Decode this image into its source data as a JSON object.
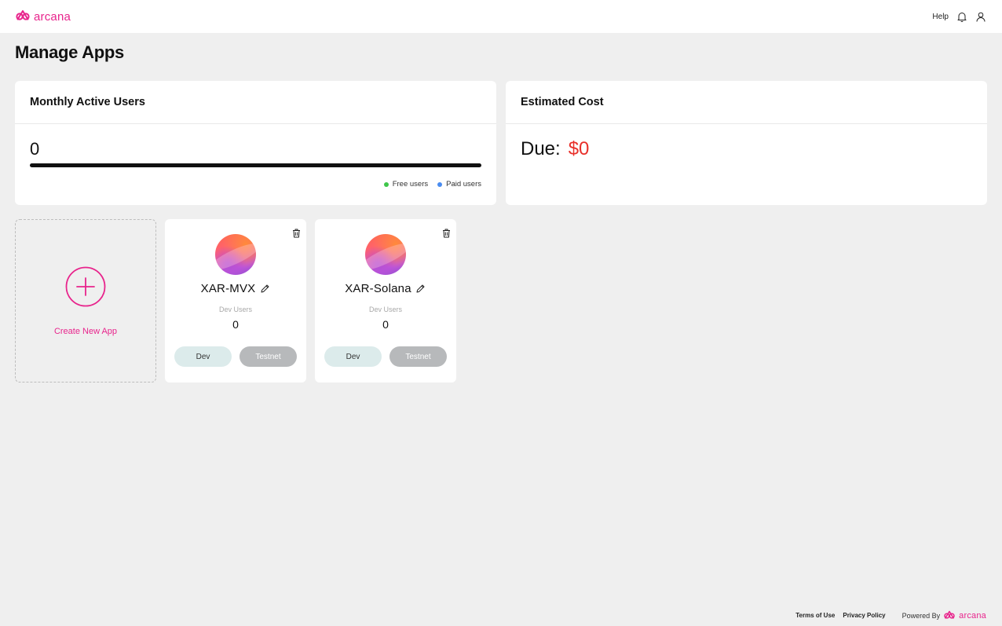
{
  "brand": {
    "name": "arcana",
    "color": "#e8248c"
  },
  "header": {
    "help_label": "Help",
    "icons": [
      "bell-icon",
      "user-icon"
    ]
  },
  "page": {
    "title": "Manage Apps"
  },
  "mau_card": {
    "title": "Monthly Active Users",
    "count": "0",
    "legend": [
      {
        "label": "Free users",
        "color": "#3ec64a"
      },
      {
        "label": "Paid users",
        "color": "#4a8cf0"
      }
    ]
  },
  "cost_card": {
    "title": "Estimated Cost",
    "due_label": "Due:",
    "due_value": "$0",
    "due_color": "#e8302a"
  },
  "create_app": {
    "label": "Create New App"
  },
  "apps": [
    {
      "name": "XAR-MVX",
      "dev_users_label": "Dev Users",
      "dev_users_count": "0",
      "dev_button": "Dev",
      "testnet_button": "Testnet"
    },
    {
      "name": "XAR-Solana",
      "dev_users_label": "Dev Users",
      "dev_users_count": "0",
      "dev_button": "Dev",
      "testnet_button": "Testnet"
    }
  ],
  "footer": {
    "terms": "Terms of Use",
    "privacy": "Privacy Policy",
    "powered_by": "Powered By",
    "brand": "arcana"
  }
}
